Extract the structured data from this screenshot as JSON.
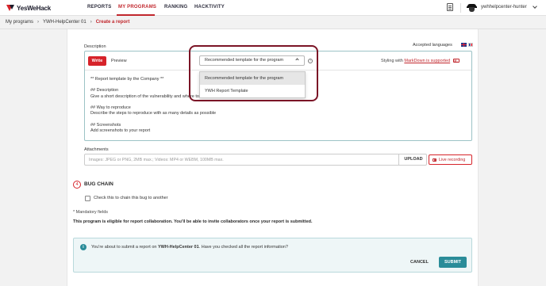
{
  "nav": {
    "logo_text": "YesWeHack",
    "items": [
      "REPORTS",
      "MY PROGRAMS",
      "RANKING",
      "HACKTIVITY"
    ],
    "username": "ywhhelpcenter-hunter"
  },
  "breadcrumb": {
    "items": [
      "My programs",
      "YWH-HelpCenter 01",
      "Create a report"
    ]
  },
  "description": {
    "label": "Description",
    "accepted_languages_label": "Accepted languages",
    "write_label": "Write",
    "preview_label": "Preview",
    "template_select_value": "Recommended template for the program",
    "help_icon": "?",
    "styling_prefix": "Styling with",
    "styling_link": "MarkDown is supported",
    "md_icon": "M↓",
    "body": "** Report template by the Company **\n\n## Description\nGive a short description of the vulnerability and where to find it\n\n## Way to reproduce\nDescribe the steps to reproduce with as many details as possible\n\n## Screenshots\nAdd screenshots to your report"
  },
  "template_dropdown": {
    "options": [
      "Recommended template for the program",
      "YWH Report Template"
    ],
    "selected_index": 0
  },
  "attachments": {
    "label": "Attachments",
    "placeholder": "Images: JPEG or PNG, 2MB max.; Videos: MP4 or WEBM, 100MB max.",
    "upload_label": "UPLOAD",
    "live_recording_label": "Live recording"
  },
  "bug_chain": {
    "step_number": "4",
    "title": "BUG CHAIN",
    "checkbox_label": "Check this to chain this bug to another"
  },
  "footer": {
    "mandatory": "* Mandatory fields",
    "collaboration": "This program is eligible for report collaboration. You'll be able to invite collaborators once your report is submitted."
  },
  "submit_box": {
    "info_icon": "i",
    "text_before": "You're about to submit a report on ",
    "program": "YWH-HelpCenter 01",
    "text_after": ". Have you checked all the report information?",
    "cancel_label": "CANCEL",
    "submit_label": "SUBMIT"
  },
  "colors": {
    "brand_red": "#d6232a",
    "accent_teal": "#2a8c99",
    "highlight": "#7b1426"
  }
}
